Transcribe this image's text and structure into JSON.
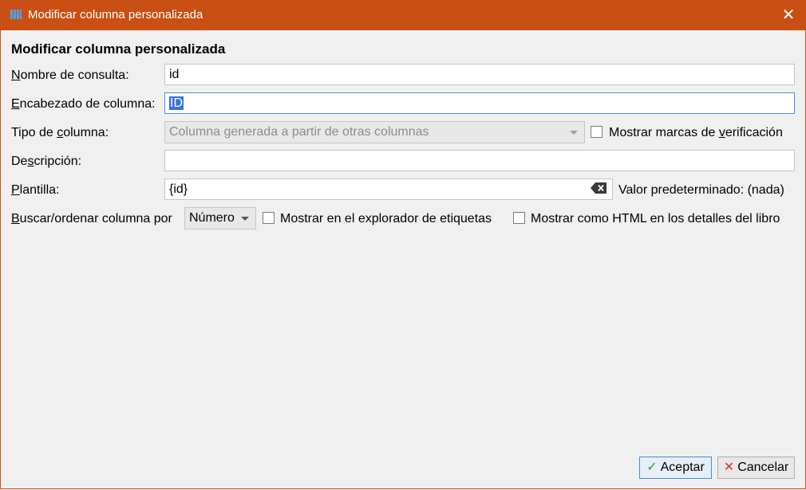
{
  "window": {
    "title": "Modificar columna personalizada",
    "close_glyph": "✕"
  },
  "heading": "Modificar columna personalizada",
  "form": {
    "lookup_name": {
      "label_mnemonic": "N",
      "label_rest": "ombre de consulta:",
      "value": "id"
    },
    "column_heading": {
      "label_mnemonic": "E",
      "label_rest": "ncabezado de columna:",
      "value": "ID"
    },
    "column_type": {
      "label_pre": "Tipo de ",
      "label_mnemonic": "c",
      "label_post": "olumna:",
      "value": "Columna generada a partir de otras columnas"
    },
    "show_checkmarks": {
      "label_pre": "Mostrar marcas de ",
      "label_mnemonic": "v",
      "label_post": "erificación",
      "checked": false
    },
    "description": {
      "label_pre": "De",
      "label_mnemonic": "s",
      "label_post": "cripción:",
      "value": ""
    },
    "template": {
      "label_mnemonic": "P",
      "label_rest": "lantilla:",
      "value": "{id}"
    },
    "default_value": "Valor predeterminado: (nada)",
    "sort_by": {
      "label_mnemonic": "B",
      "label_rest": "uscar/ordenar columna por",
      "value": "Número"
    },
    "show_in_tag_browser": {
      "label": "Mostrar en el explorador de etiquetas",
      "checked": false
    },
    "show_as_html": {
      "label": "Mostrar como HTML en los detalles del libro",
      "checked": false
    }
  },
  "buttons": {
    "ok": {
      "label": "Aceptar",
      "icon": "check-icon"
    },
    "cancel": {
      "label": "Cancelar",
      "icon": "x-icon"
    }
  },
  "colors": {
    "titlebar": "#c94f14",
    "accept_icon": "#2e9e3e",
    "cancel_icon": "#d03a2e",
    "selection": "#3874d8"
  }
}
